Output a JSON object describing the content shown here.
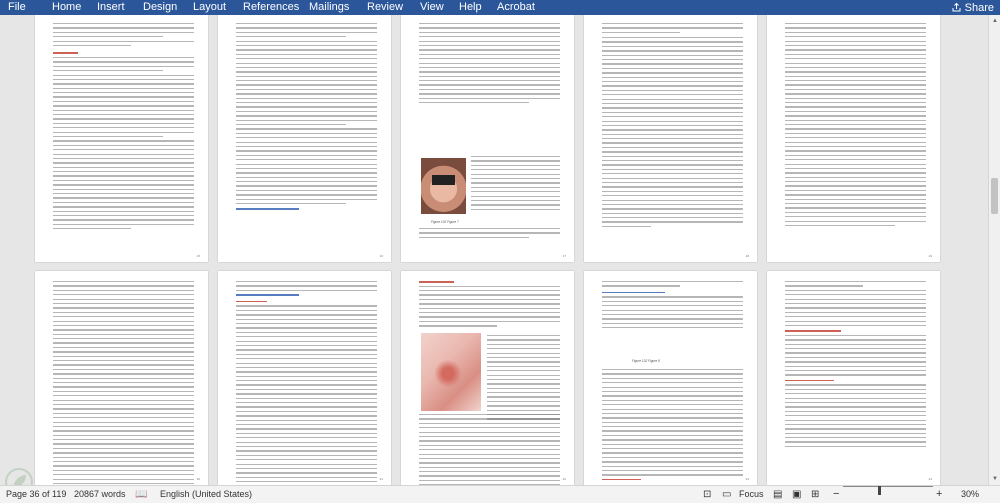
{
  "ribbon": {
    "tabs": [
      "File",
      "Home",
      "Insert",
      "Design",
      "Layout",
      "References",
      "Mailings",
      "Review",
      "View",
      "Help",
      "Acrobat"
    ],
    "share_label": "Share"
  },
  "document": {
    "page_numbers_top": [
      "15",
      "16",
      "17",
      "18",
      "19"
    ],
    "page_numbers_bottom": [
      "20",
      "21",
      "22",
      "23",
      "24"
    ],
    "figure_caption_top": "Figure 102 Figure 7",
    "figure_caption_bottom": "Figure 102 Figure 8"
  },
  "status": {
    "page": "Page 36 of 119",
    "words": "20867 words",
    "language": "English (United States)",
    "focus": "Focus",
    "zoom": "30%",
    "zoom_fraction": 0.3
  },
  "colors": {
    "ribbon": "#2b579a",
    "heading_red": "#c0392b",
    "heading_blue": "#2a5db0"
  }
}
